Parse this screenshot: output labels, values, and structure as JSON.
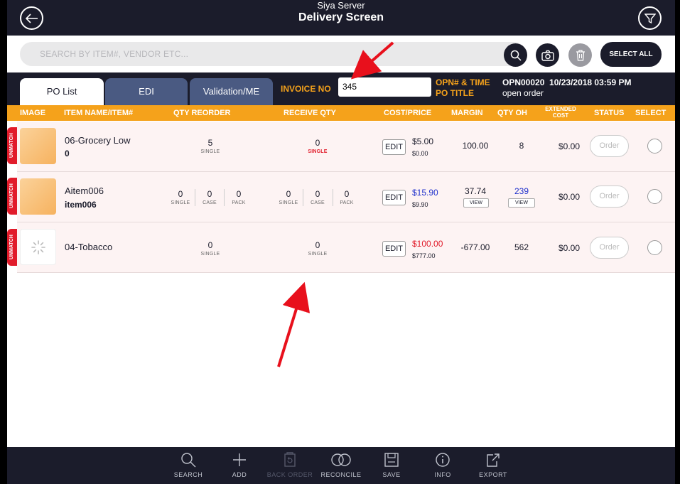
{
  "header": {
    "server_name": "Siya Server",
    "title": "Delivery Screen"
  },
  "search": {
    "placeholder": "SEARCH BY ITEM#, VENDOR ETC...",
    "select_all_label": "SELECT ALL"
  },
  "tabs": [
    {
      "label": "PO List",
      "active": true
    },
    {
      "label": "EDI",
      "active": false
    },
    {
      "label": "Validation/ME",
      "active": false
    }
  ],
  "invoice": {
    "label": "INVOICE NO",
    "value": "345"
  },
  "opn": {
    "label_line1": "OPN# & TIME",
    "label_line2": "PO TITLE",
    "value_line1": "OPN00020  10/23/2018 03:59 PM",
    "value_line2": "open order"
  },
  "columns": {
    "image": "IMAGE",
    "item": "ITEM NAME/ITEM#",
    "qty_reorder": "QTY REORDER",
    "receive_qty": "RECEIVE QTY",
    "cost_price": "COST/PRICE",
    "margin": "MARGIN",
    "qty_oh": "QTY OH",
    "extended_cost_1": "EXTENDED",
    "extended_cost_2": "COST",
    "status": "STATUS",
    "select": "SELECT"
  },
  "rows": [
    {
      "badge": "UNMATCH",
      "name": "06-Grocery Low",
      "code": "0",
      "reorder_value": "5",
      "reorder_unit": "SINGLE",
      "receive_value": "0",
      "receive_unit": "SINGLE",
      "edit_label": "EDIT",
      "price": "$5.00",
      "cost": "$0.00",
      "margin": "100.00",
      "qty_oh": "8",
      "extended_cost": "$0.00",
      "status_label": "Order"
    },
    {
      "badge": "UNMATCH",
      "name": "Aitem006",
      "code": "item006",
      "reorder": [
        {
          "value": "0",
          "unit": "SINGLE"
        },
        {
          "value": "0",
          "unit": "CASE"
        },
        {
          "value": "0",
          "unit": "PACK"
        }
      ],
      "receive": [
        {
          "value": "0",
          "unit": "SINGLE"
        },
        {
          "value": "0",
          "unit": "CASE"
        },
        {
          "value": "0",
          "unit": "PACK"
        }
      ],
      "edit_label": "EDIT",
      "price": "$15.90",
      "cost": "$9.90",
      "margin": "37.74",
      "margin_view": "VIEW",
      "qty_oh": "239",
      "qty_oh_view": "VIEW",
      "extended_cost": "$0.00",
      "status_label": "Order"
    },
    {
      "badge": "UNMATCH",
      "name": "04-Tobacco",
      "code": "",
      "reorder_value": "0",
      "reorder_unit": "SINGLE",
      "receive_value": "0",
      "receive_unit": "SINGLE",
      "edit_label": "EDIT",
      "price": "$100.00",
      "cost": "$777.00",
      "margin": "-677.00",
      "qty_oh": "562",
      "extended_cost": "$0.00",
      "status_label": "Order"
    }
  ],
  "footer": [
    {
      "label": "SEARCH",
      "icon": "search-icon",
      "enabled": true
    },
    {
      "label": "ADD",
      "icon": "plus-icon",
      "enabled": true
    },
    {
      "label": "BACK ORDER",
      "icon": "back-order-icon",
      "enabled": false
    },
    {
      "label": "RECONCILE",
      "icon": "reconcile-icon",
      "enabled": true
    },
    {
      "label": "SAVE",
      "icon": "save-icon",
      "enabled": true
    },
    {
      "label": "INFO",
      "icon": "info-icon",
      "enabled": true
    },
    {
      "label": "EXPORT",
      "icon": "export-icon",
      "enabled": true
    }
  ],
  "colors": {
    "navy": "#1b1c2b",
    "orange": "#f5a21b",
    "tab_inactive": "#4a5a82",
    "unmatch_red": "#e11b2a",
    "price_blue": "#2233cc",
    "price_red": "#e11b2a",
    "annotation_arrow": "#e8101c"
  }
}
